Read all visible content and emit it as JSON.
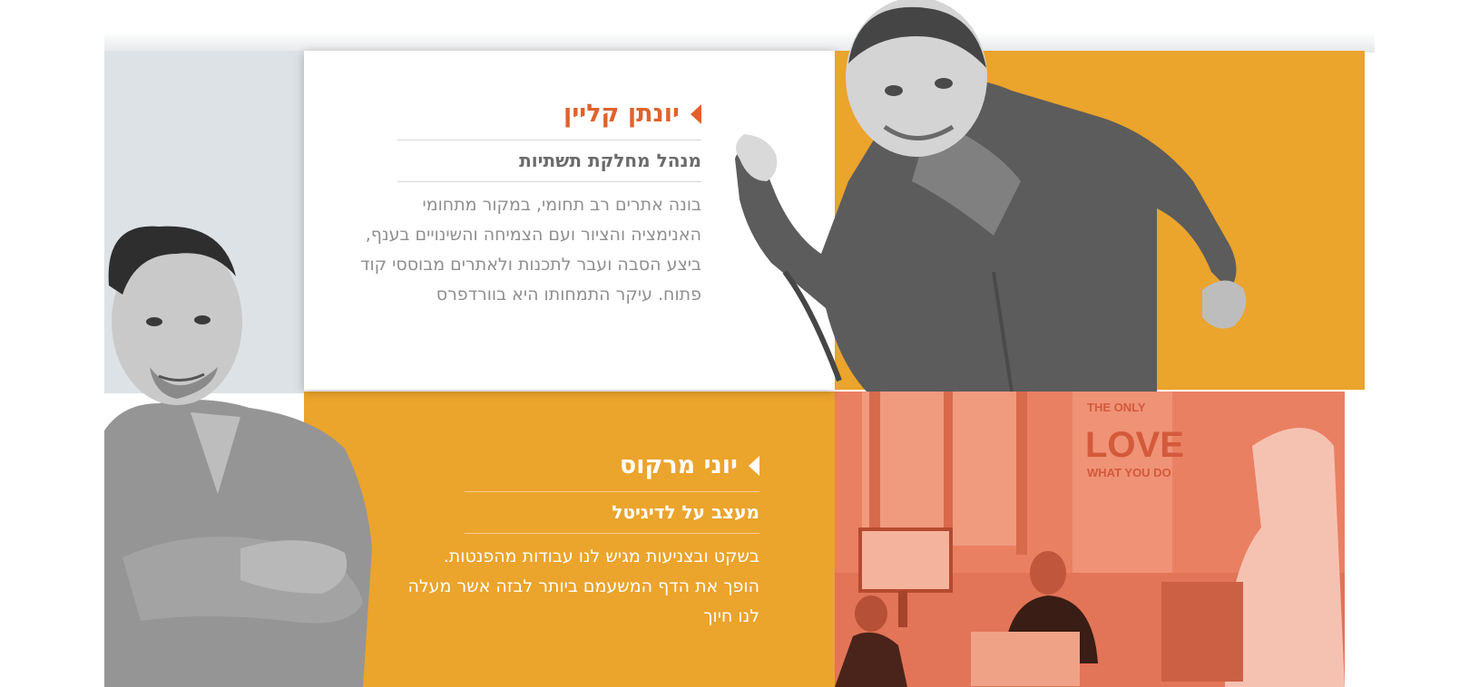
{
  "team": [
    {
      "name": "יונתן קליין",
      "role": "מנהל מחלקת תשתיות",
      "description": "בונה אתרים רב תחומי, במקור מתחומי האנימציה והציור ועם הצמיחה והשינויים בענף, ביצע הסבה ועבר לתכנות ולאתרים מבוססי קוד פתוח. עיקר התמחותו היא בוורדפרס"
    },
    {
      "name": "יוני מרקוס",
      "role": "מעצב על לדיגיטל",
      "description": "בשקט ובצניעות מגיש לנו עבודות מהפנטות. הופך את הדף המשעמם ביותר לבזה אשר מעלה לנו חיוך"
    }
  ],
  "office_poster": {
    "line1": "THE ONLY",
    "line2": "LOVE",
    "line3": "WHAT YOU DO"
  },
  "colors": {
    "orange": "#eba42c",
    "accent": "#e0622a",
    "grey_panel": "#dde2e6",
    "photo_tint": "#ea8062"
  },
  "icons": [
    "arrow-left-icon"
  ]
}
